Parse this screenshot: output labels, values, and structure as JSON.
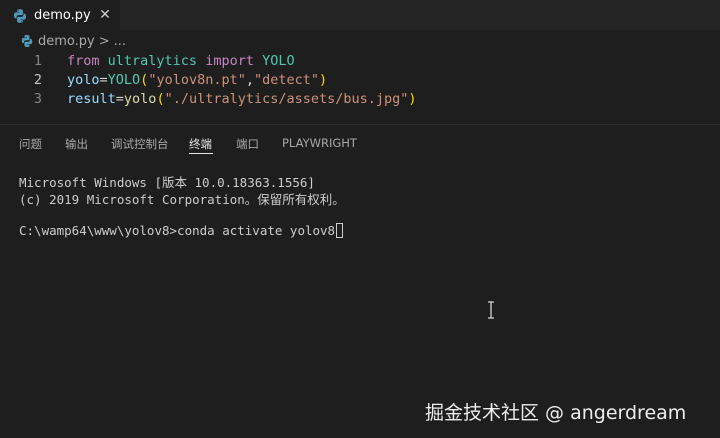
{
  "tab": {
    "title": "demo.py",
    "close_glyph": "✕"
  },
  "breadcrumb": {
    "file": "demo.py",
    "separator": ">",
    "more": "..."
  },
  "editor": {
    "lines": [
      {
        "number": "1",
        "tokens": {
          "kw1": "from",
          "mod": "ultralytics",
          "kw2": "import",
          "cls": "YOLO"
        }
      },
      {
        "number": "2",
        "tokens": {
          "var": "yolo",
          "eq": "=",
          "cls": "YOLO",
          "open": "(",
          "s1": "\"yolov8n.pt\"",
          "comma": ",",
          "s2": "\"detect\"",
          "close": ")"
        }
      },
      {
        "number": "3",
        "tokens": {
          "var": "result",
          "eq": "=",
          "fn": "yolo",
          "open": "(",
          "s1": "\"./ultralytics/assets/bus.jpg\"",
          "close": ")"
        }
      }
    ],
    "active_line": "2"
  },
  "panel_tabs": [
    "问题",
    "输出",
    "调试控制台",
    "终端",
    "端口",
    "PLAYWRIGHT"
  ],
  "active_panel_tab": "终端",
  "terminal": {
    "lines": [
      "Microsoft Windows [版本 10.0.18363.1556]",
      "(c) 2019 Microsoft Corporation。保留所有权利。",
      "",
      "C:\\wamp64\\www\\yolov8>conda activate yolov8"
    ]
  },
  "watermark": "掘金技术社区 @ angerdream",
  "colors": {
    "editor_bg": "#1e1e1e",
    "tabbar_bg": "#252526",
    "python_blue": "#519aba"
  },
  "icons": [
    "python-file-icon",
    "close-icon",
    "text-cursor-icon"
  ]
}
